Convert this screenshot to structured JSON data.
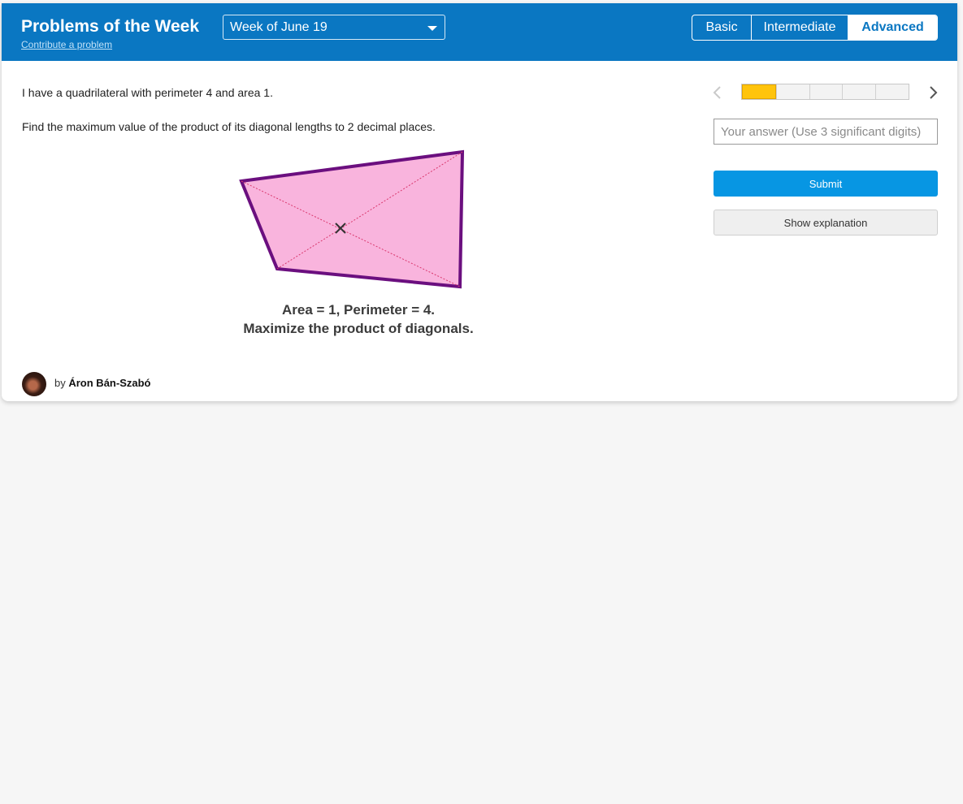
{
  "header": {
    "title": "Problems of the Week",
    "contribute_link": "Contribute a problem",
    "week_select": {
      "value": "Week of June 19"
    },
    "levels": [
      "Basic",
      "Intermediate",
      "Advanced"
    ],
    "selected_level": "Advanced"
  },
  "problem": {
    "statement": "I have a quadrilateral with perimeter 4 and area 1.",
    "question": "Find the maximum value of the product of its diagonal lengths to 2 decimal places.",
    "figure_caption_line1": "Area = 1, Perimeter = 4.",
    "figure_caption_line2": "Maximize the product of diagonals."
  },
  "author": {
    "by": "by",
    "name": "Áron Bán-Szabó"
  },
  "sidebar": {
    "progress": {
      "total_segments": 5,
      "current": 1
    },
    "answer_placeholder": "Your answer (Use 3 significant digits)",
    "submit_label": "Submit",
    "explanation_label": "Show explanation"
  },
  "colors": {
    "header_bg": "#0a77c2",
    "progress_fill": "#ffc40c",
    "submit_bg": "#0796e3",
    "shape_fill": "#f9b4dd",
    "shape_stroke": "#6b0f7f"
  }
}
